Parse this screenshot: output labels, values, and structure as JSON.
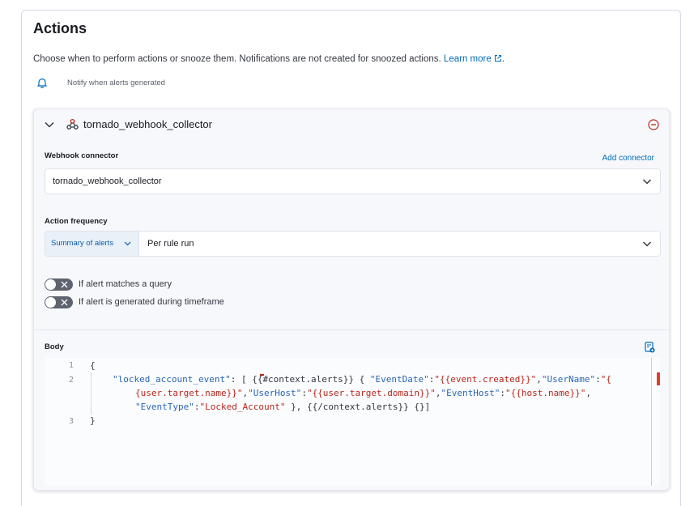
{
  "section": {
    "title": "Actions",
    "description": "Choose when to perform actions or snooze them. Notifications are not created for snoozed actions.",
    "learn_more": "Learn more",
    "notify_text": "Notify when alerts generated"
  },
  "action": {
    "title": "tornado_webhook_collector",
    "connector_label": "Webhook connector",
    "add_connector": "Add connector",
    "connector_value": "tornado_webhook_collector",
    "frequency_label": "Action frequency",
    "frequency_prepend": "Summary of alerts",
    "frequency_value": "Per rule run",
    "toggles": [
      {
        "label": "If alert matches a query",
        "on": false
      },
      {
        "label": "If alert is generated during timeframe",
        "on": false
      }
    ],
    "body_label": "Body"
  },
  "editor": {
    "line_numbers": [
      "1",
      "2",
      "3"
    ],
    "lines": [
      [
        {
          "t": "p",
          "v": "{"
        }
      ],
      [
        {
          "t": "k",
          "v": "\"locked_account_event\""
        },
        {
          "t": "p",
          "v": ": [ {{#context.alerts}} { "
        },
        {
          "t": "k",
          "v": "\"EventDate\""
        },
        {
          "t": "p",
          "v": ":"
        },
        {
          "t": "s",
          "v": "\"{{event.created}}\""
        },
        {
          "t": "p",
          "v": ","
        },
        {
          "t": "k",
          "v": "\"UserName\""
        },
        {
          "t": "p",
          "v": ":"
        },
        {
          "t": "s",
          "v": "\"{"
        }
      ],
      [
        {
          "t": "s",
          "v": "{user.target.name}}\""
        },
        {
          "t": "p",
          "v": ","
        },
        {
          "t": "k",
          "v": "\"UserHost\""
        },
        {
          "t": "p",
          "v": ":"
        },
        {
          "t": "s",
          "v": "\"{{user.target.domain}}\""
        },
        {
          "t": "p",
          "v": ","
        },
        {
          "t": "k",
          "v": "\"EventHost\""
        },
        {
          "t": "p",
          "v": ":"
        },
        {
          "t": "s",
          "v": "\"{{host.name}}\""
        },
        {
          "t": "p",
          "v": ","
        }
      ],
      [
        {
          "t": "k",
          "v": "\"EventType\""
        },
        {
          "t": "p",
          "v": ":"
        },
        {
          "t": "s",
          "v": "\"Locked_Account\""
        },
        {
          "t": "p",
          "v": " }, {{/context.alerts}} {}]"
        }
      ],
      [
        {
          "t": "p",
          "v": "}"
        }
      ]
    ]
  },
  "colors": {
    "link": "#006bb8",
    "danger": "#bd271e",
    "string": "#b8261c",
    "key": "#2a66b8"
  }
}
